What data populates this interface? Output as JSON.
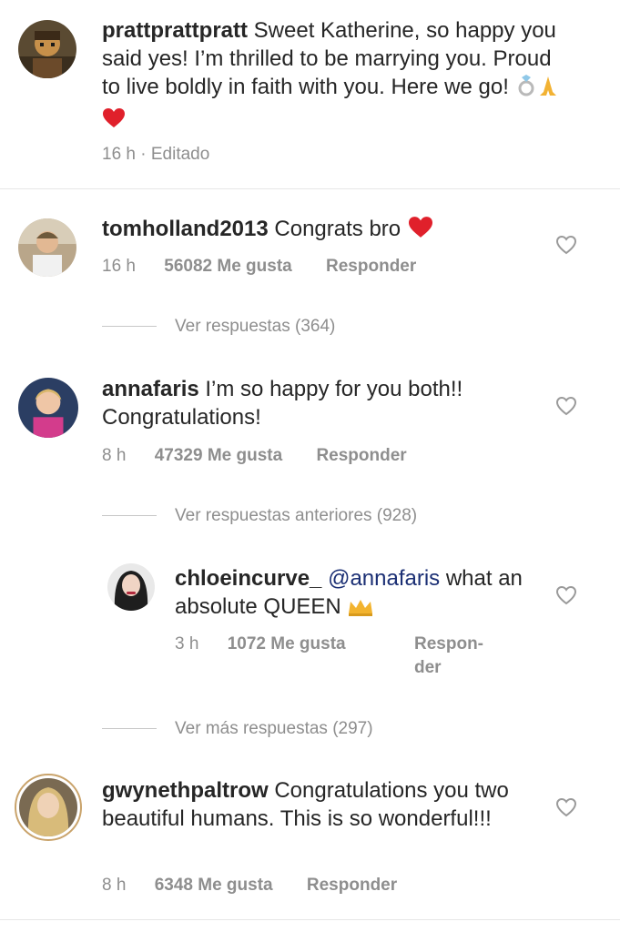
{
  "caption": {
    "username": "prattprattpratt",
    "text": "Sweet Katherine, so happy you said yes! I’m thrilled to be marrying you. Proud to live boldly in faith with you. Here we go!",
    "time": "16 h",
    "edited": "· Editado"
  },
  "comments": [
    {
      "username": "tomholland2013",
      "text": "Congrats bro",
      "time": "16 h",
      "likes": "56082 Me gusta",
      "reply": "Responder",
      "view_replies": "Ver respuestas (364)"
    },
    {
      "username": "annafaris",
      "text": "I’m so happy for you both!! Congratulations!",
      "time": "8 h",
      "likes": "47329 Me gusta",
      "reply": "Responder",
      "view_replies": "Ver respuestas anteriores (928)"
    },
    {
      "username": "gwynethpaltrow",
      "text": "Congratulations you two beautiful humans. This is so wonderful!!!",
      "time": "8 h",
      "likes": "6348 Me gusta",
      "reply": "Responder"
    }
  ],
  "reply": {
    "username": "chloeincurve_",
    "mention": "@annafaris",
    "text": "what an absolute QUEEN",
    "time": "3 h",
    "likes": "1072 Me gusta",
    "reply_line1": "Respon-",
    "reply_line2": "der",
    "view_more": "Ver más respuestas (297)"
  },
  "icons": {
    "like": "heart-outline-icon",
    "ring": "ring-emoji",
    "pray": "folded-hands-emoji",
    "red_heart": "red-heart-emoji",
    "crown": "crown-emoji"
  },
  "colors": {
    "username": "#262626",
    "meta": "#8e8e8e",
    "mention": "#1b2f74",
    "heart_red": "#e0202b",
    "story_ring": "#c9a36b"
  }
}
